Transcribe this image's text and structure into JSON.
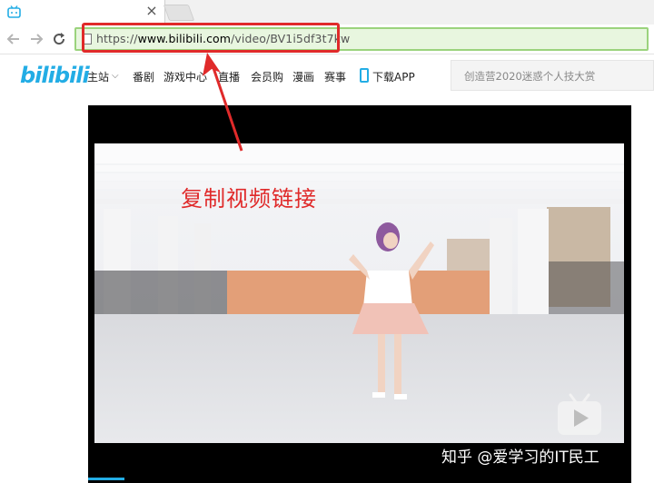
{
  "browser": {
    "tab_close": "×",
    "url_prefix": "https://",
    "url_domain": "www.bilibili.com",
    "url_path": "/video/BV1i5df3t7kw"
  },
  "site": {
    "logo": "bilibili",
    "nav": {
      "home": "主站",
      "home_caret": "⌵",
      "bangumi": "番剧",
      "game_center": "游戏中心",
      "live": "直播",
      "vip_shop": "会员购",
      "manga": "漫画",
      "esports": "赛事",
      "download_app": "下载APP"
    },
    "search": {
      "placeholder": "创造营2020迷惑个人技大赏"
    }
  },
  "annotation": {
    "callout": "复制视频链接",
    "highlight_color": "#e02a2a"
  },
  "watermark": "知乎 @爱学习的IT民工",
  "colors": {
    "brand": "#23ade5",
    "omnibox_border": "#9bd37d"
  }
}
